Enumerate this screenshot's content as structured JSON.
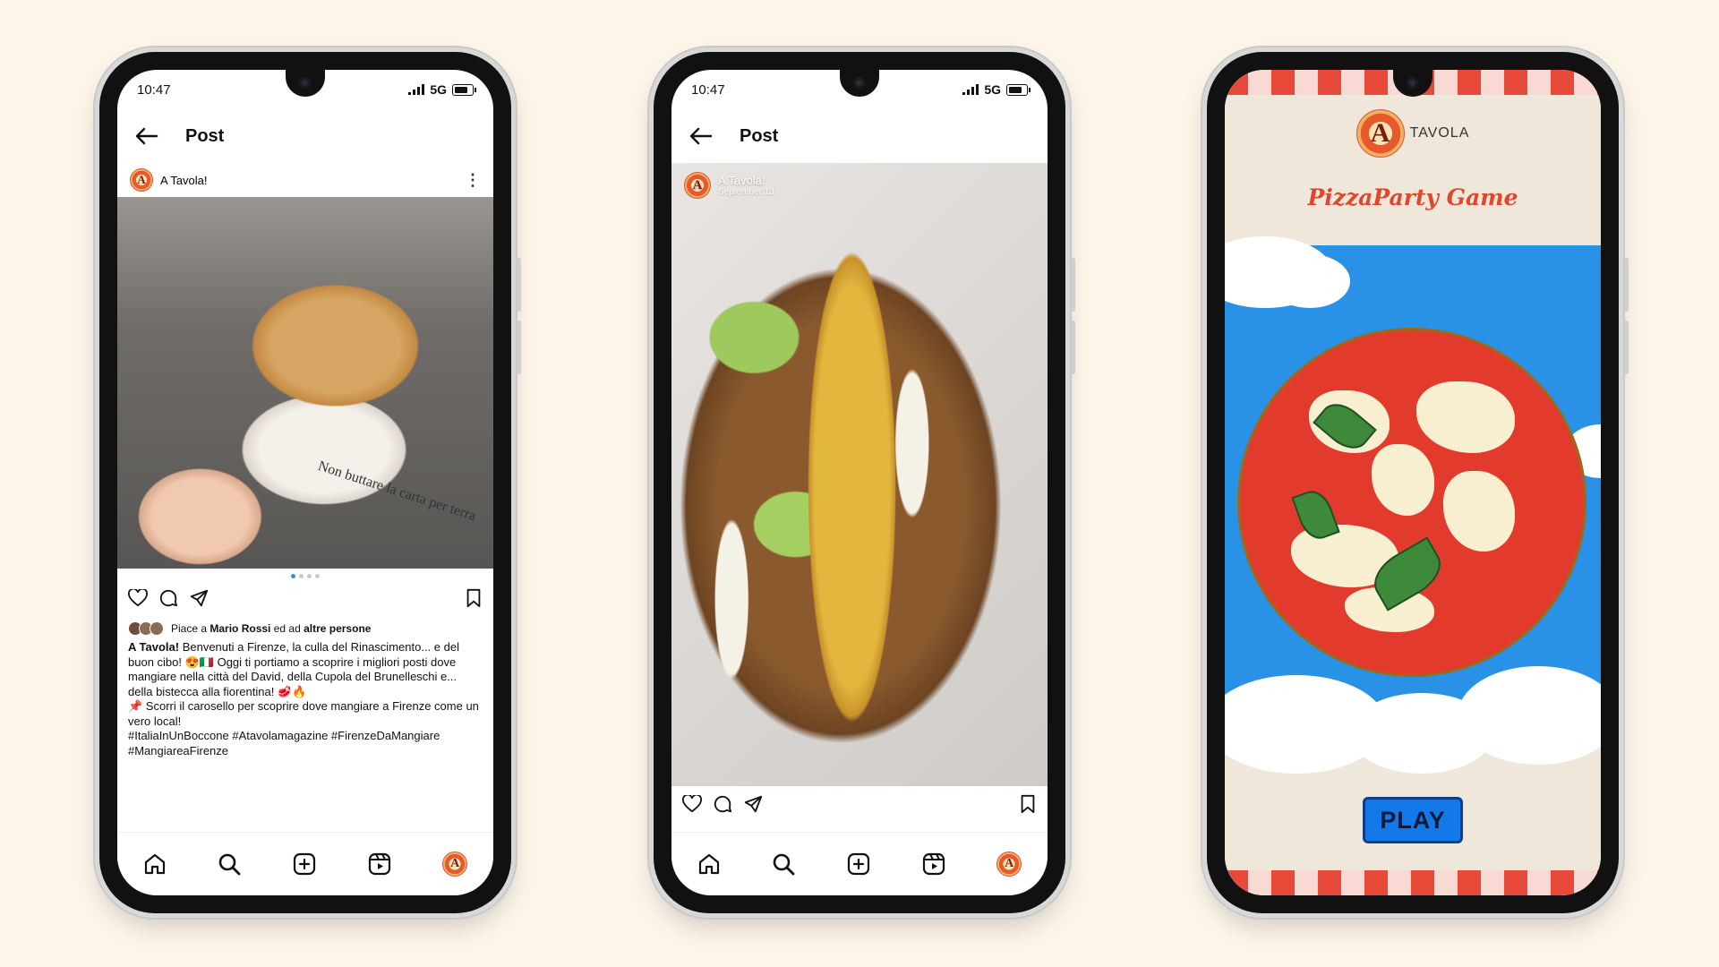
{
  "colors": {
    "background": "#fdf5e8",
    "accent_blue": "#2b8ef0",
    "game_title_red": "#e2462a",
    "play_blue": "#1479e8",
    "sky_blue": "#2a92e6"
  },
  "phone1": {
    "status": {
      "time": "10:47",
      "network": "5G"
    },
    "header": {
      "title": "Post"
    },
    "account": {
      "name": "A Tavola!"
    },
    "photo": {
      "wrap_text": "Non buttare la carta per terra"
    },
    "likes": {
      "prefix": "Piace a ",
      "user": "Mario Rossi",
      "middle": " ed ad ",
      "others": "altre persone"
    },
    "caption": {
      "author": "A Tavola!",
      "line1": " Benvenuti a Firenze, la culla del Rinascimento... e del buon cibo! 😍🇮🇹 Oggi ti portiamo a scoprire i migliori posti dove mangiare nella città del David, della Cupola del Brunelleschi e... della bistecca alla fiorentina! 🥩🔥",
      "line2": "📌 Scorri il carosello per scoprire dove mangiare a Firenze come un vero local!",
      "hashtags": "#ItaliaInUnBoccone #Atavolamagazine #FirenzeDaMangiare #MangiareaFirenze"
    },
    "carousel": {
      "count": 4,
      "active": 1
    }
  },
  "phone2": {
    "status": {
      "time": "10:47",
      "network": "5G"
    },
    "header": {
      "title": "Post"
    },
    "account": {
      "name": "A Tavola!",
      "date": "September 13"
    }
  },
  "phone3": {
    "brand": "TAVOLA",
    "logo_letter": "A",
    "title": "PizzaParty Game",
    "play_label": "PLAY"
  },
  "nav_icons": [
    "home-icon",
    "search-icon",
    "add-post-icon",
    "reels-icon",
    "profile-avatar"
  ],
  "action_icons": [
    "heart-icon",
    "comment-icon",
    "share-icon",
    "bookmark-icon"
  ]
}
